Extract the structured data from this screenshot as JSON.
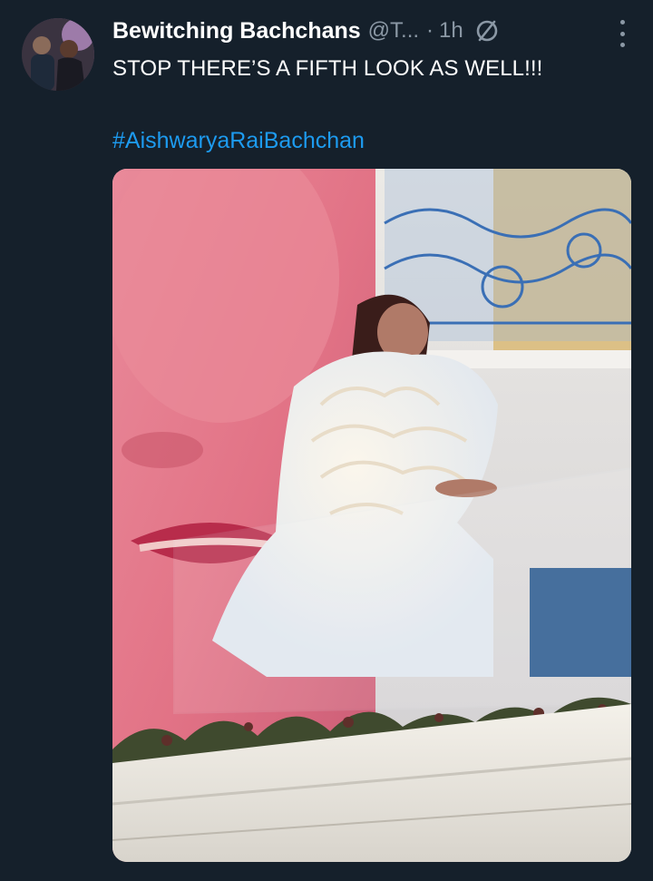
{
  "tweet": {
    "display_name": "Bewitching Bachchans",
    "handle": "@T...",
    "separator": "·",
    "time": "1h",
    "text": "STOP THERE’S A FIFTH LOOK AS WELL!!!",
    "hashtag": "#AishwaryaRaiBachchan"
  },
  "icons": {
    "avatar": "profile-photo",
    "status": "circle-slash-icon",
    "more": "more-vertical-icon"
  },
  "colors": {
    "background": "#15202b",
    "text": "#ffffff",
    "muted": "#8b98a5",
    "link": "#1d9bf0"
  }
}
